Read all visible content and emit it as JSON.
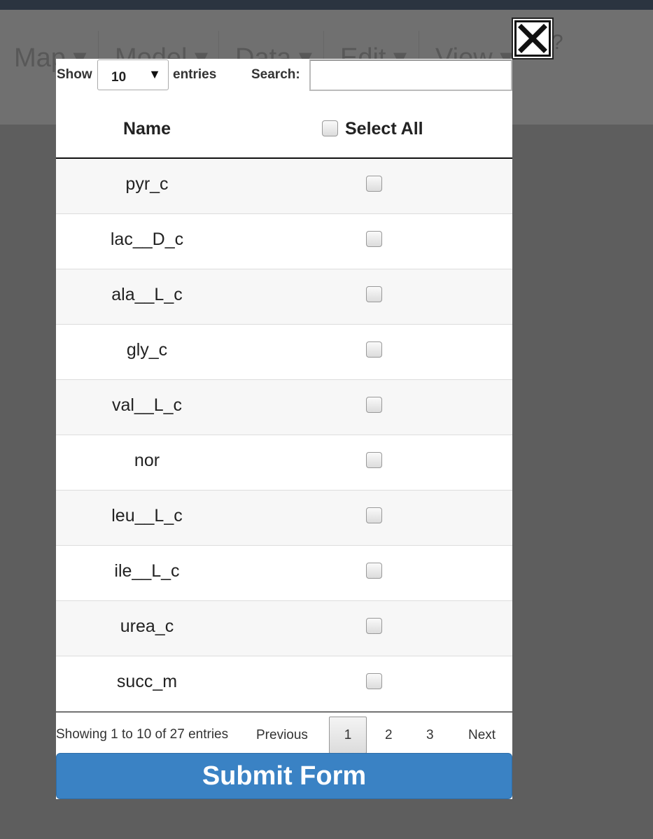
{
  "background": {
    "menu": [
      "Map",
      "Model",
      "Data",
      "Edit",
      "View"
    ],
    "help": "?"
  },
  "modal": {
    "close_icon": "close-icon",
    "show_label": "Show",
    "entries_select": "10",
    "entries_label": "entries",
    "search_label": "Search:",
    "search_value": "",
    "columns": {
      "name": "Name",
      "select_all": "Select All"
    },
    "rows": [
      {
        "name": "pyr_c"
      },
      {
        "name": "lac__D_c"
      },
      {
        "name": "ala__L_c"
      },
      {
        "name": "gly_c"
      },
      {
        "name": "val__L_c"
      },
      {
        "name": "nor"
      },
      {
        "name": "leu__L_c"
      },
      {
        "name": "ile__L_c"
      },
      {
        "name": "urea_c"
      },
      {
        "name": "succ_m"
      }
    ],
    "info": "Showing 1 to 10 of 27 entries",
    "pagination": {
      "previous": "Previous",
      "pages": [
        "1",
        "2",
        "3"
      ],
      "current": "1",
      "next": "Next"
    },
    "submit_label": "Submit Form"
  },
  "colors": {
    "submit": "#3a82c4",
    "overlay": "#5e5e5e"
  }
}
